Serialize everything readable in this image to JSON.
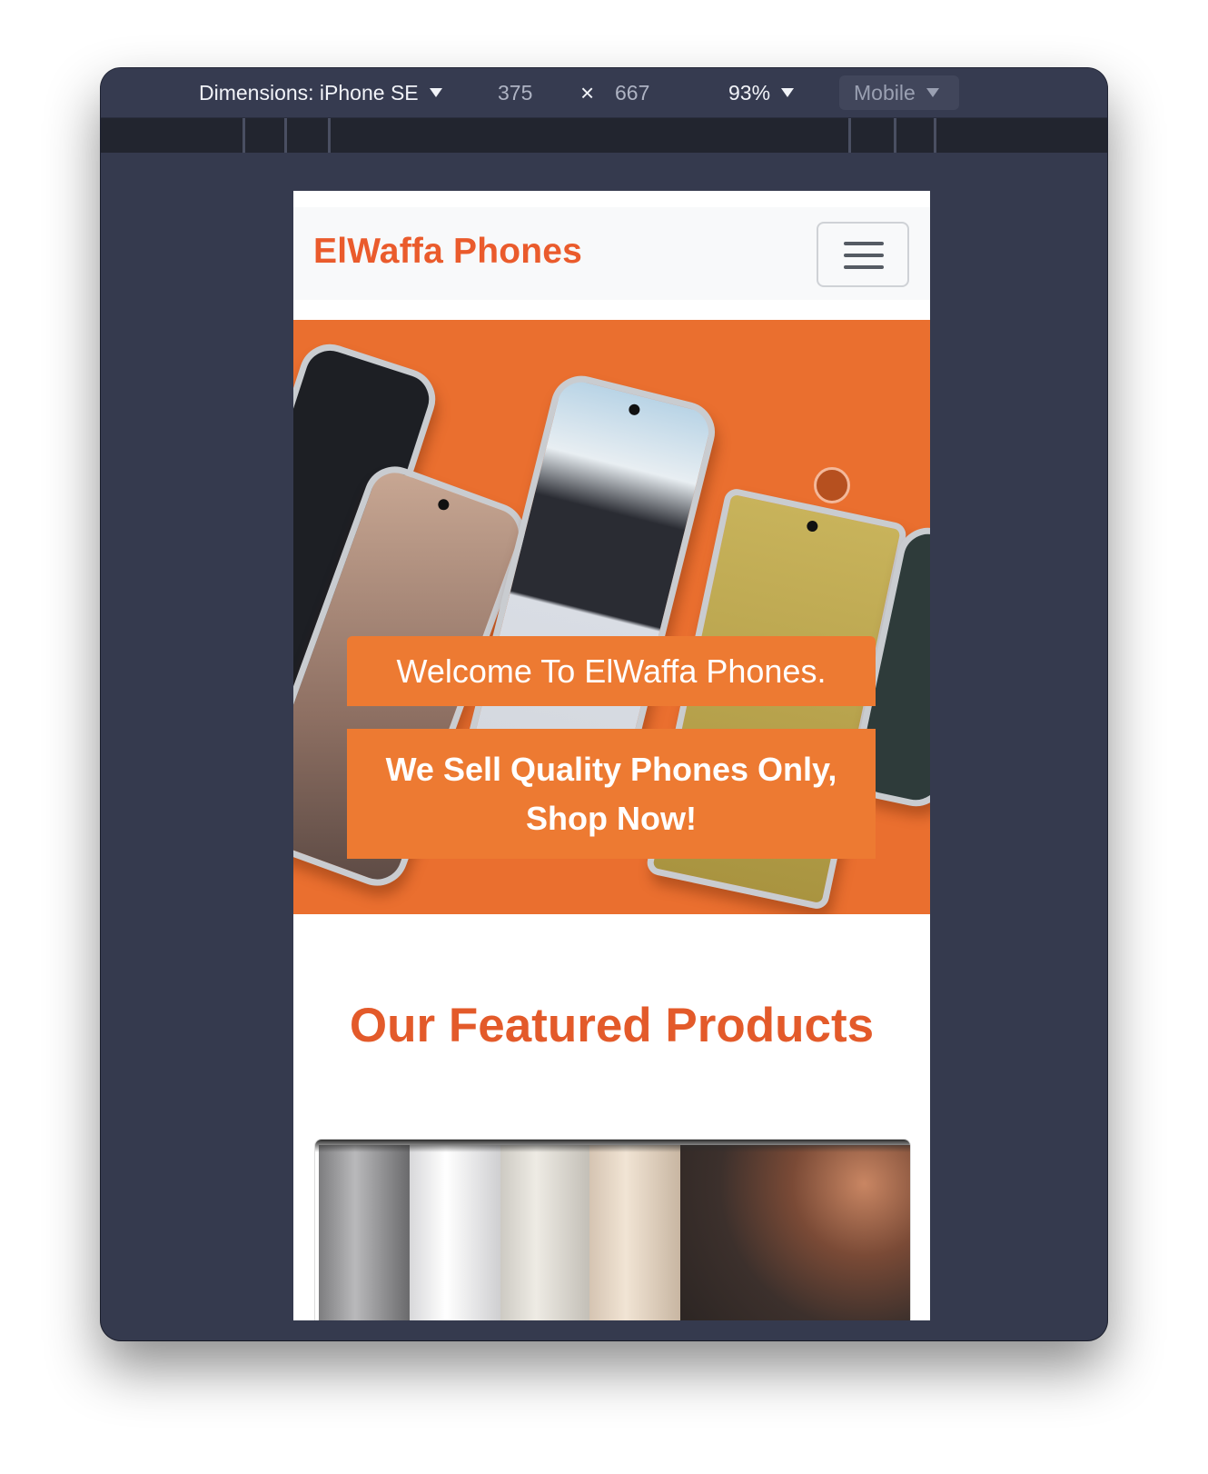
{
  "toolbar": {
    "dimensions_label": "Dimensions: iPhone SE",
    "width": "375",
    "times": "×",
    "height": "667",
    "zoom": "93%",
    "mode": "Mobile"
  },
  "site": {
    "brand": "ElWaffa Phones",
    "menu_icon": "hamburger-menu-icon"
  },
  "hero": {
    "caption_title": "Welcome To ElWaffa Phones.",
    "caption_text": "We Sell Quality Phones Only, Shop Now!"
  },
  "featured": {
    "heading": "Our Featured Products"
  },
  "colors": {
    "brand": "#ea5b2c",
    "hero_bg": "#ea6f2f",
    "caption_bg": "#ed7a32",
    "devtools_bg": "#353a4e"
  }
}
